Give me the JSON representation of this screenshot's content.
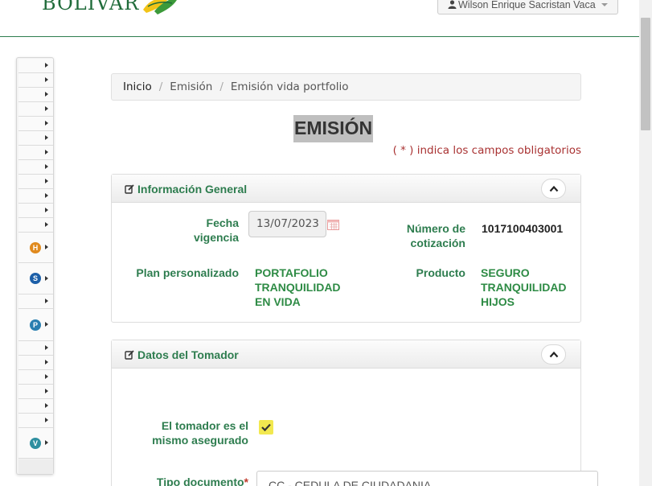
{
  "header": {
    "logo_text": "BOLIVAR",
    "user_name": "Wilson Enrique Sacristan Vaca"
  },
  "breadcrumb": {
    "home": "Inicio",
    "items": [
      "Emisión",
      "Emisión vida portfolio"
    ]
  },
  "page": {
    "title": "EMISIÓN",
    "required_note": "( * ) indica los campos obligatorios"
  },
  "general_info": {
    "title": "Información General",
    "fecha_vigencia_label": "Fecha vigencia",
    "fecha_vigencia_value": "13/07/2023",
    "numero_cotizacion_label": "Número de cotización",
    "numero_cotizacion_value": "1017100403001",
    "plan_label": "Plan personalizado",
    "plan_value": "PORTAFOLIO TRANQUILIDAD EN VIDA",
    "producto_label": "Producto",
    "producto_value": "SEGURO TRANQUILIDAD HIJOS"
  },
  "tomador": {
    "title": "Datos del Tomador",
    "mismo_asegurado_label": "El tomador es el mismo asegurado",
    "mismo_asegurado_checked": true,
    "tipo_documento_label": "Tipo documento",
    "required_mark": "*",
    "tipo_documento_value": "CC - CEDULA DE CIUDADANIA"
  },
  "sidebar": {
    "badges": [
      {
        "letter": "H",
        "color": "#e08a1e"
      },
      {
        "letter": "S",
        "color": "#1c5fa8"
      },
      {
        "letter": "P",
        "color": "#2a7fb0"
      },
      {
        "letter": "V",
        "color": "#2f8fa0"
      }
    ]
  },
  "colors": {
    "brand_green": "#2e7d4f",
    "required_red": "#a93232",
    "checkbox_yellow": "#f2e84f"
  }
}
